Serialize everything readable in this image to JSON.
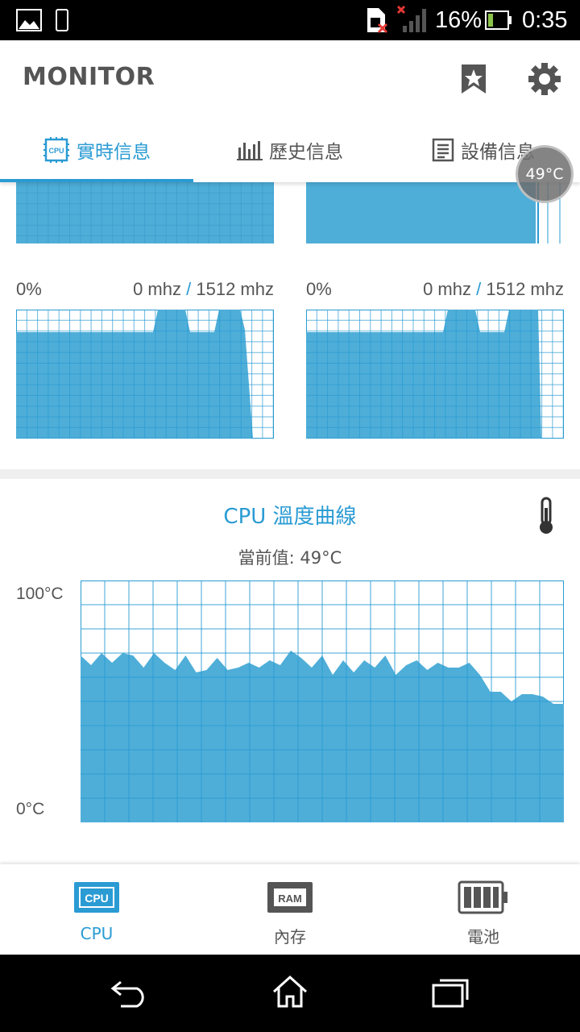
{
  "status_bar": {
    "battery_percent": "16%",
    "time": "0:35"
  },
  "header": {
    "title": "MONITOR",
    "icons": [
      "bookmark-star-icon",
      "gear-icon"
    ]
  },
  "tabs": [
    {
      "label": "實時信息",
      "icon": "cpu-chip-icon",
      "active": true
    },
    {
      "label": "歷史信息",
      "icon": "bar-chart-icon",
      "active": false
    },
    {
      "label": "設備信息",
      "icon": "list-document-icon",
      "active": false
    }
  ],
  "temp_bubble": "49°C",
  "cores": [
    {
      "usage": "0%",
      "freq_current": "0 mhz",
      "freq_max": "1512 mhz"
    },
    {
      "usage": "0%",
      "freq_current": "0 mhz",
      "freq_max": "1512 mhz"
    }
  ],
  "freq_separator": "/",
  "temperature": {
    "title": "CPU 溫度曲線",
    "current_label": "當前值: 49°C",
    "y_max_label": "100°C",
    "y_min_label": "0°C",
    "icon": "thermometer-icon"
  },
  "chart_data": [
    {
      "type": "area",
      "series": [
        {
          "values": [
            69,
            65,
            70,
            66,
            70,
            69,
            64,
            70,
            66,
            63,
            69,
            62,
            63,
            68,
            63,
            64,
            66,
            64,
            67,
            65,
            71,
            68,
            64,
            69,
            61,
            67,
            62,
            67,
            64,
            69,
            61,
            65,
            67,
            63,
            66,
            64,
            64,
            66,
            61,
            54,
            54,
            50,
            53,
            53,
            52,
            49,
            49
          ]
        }
      ],
      "ylim": [
        0,
        100
      ],
      "yticks": [
        "100°C",
        "0°C"
      ],
      "grid": true,
      "ylabel": "",
      "xlabel": ""
    }
  ],
  "bottom_nav": [
    {
      "label": "CPU",
      "icon": "cpu-chip-icon",
      "active": true
    },
    {
      "label": "內存",
      "icon": "ram-chip-icon",
      "active": false
    },
    {
      "label": "電池",
      "icon": "battery-icon",
      "active": false
    }
  ],
  "colors": {
    "accent": "#2a9bd3",
    "chart_fill": "#4eaed8",
    "grid": "#2a9bd3",
    "text": "#555555"
  }
}
